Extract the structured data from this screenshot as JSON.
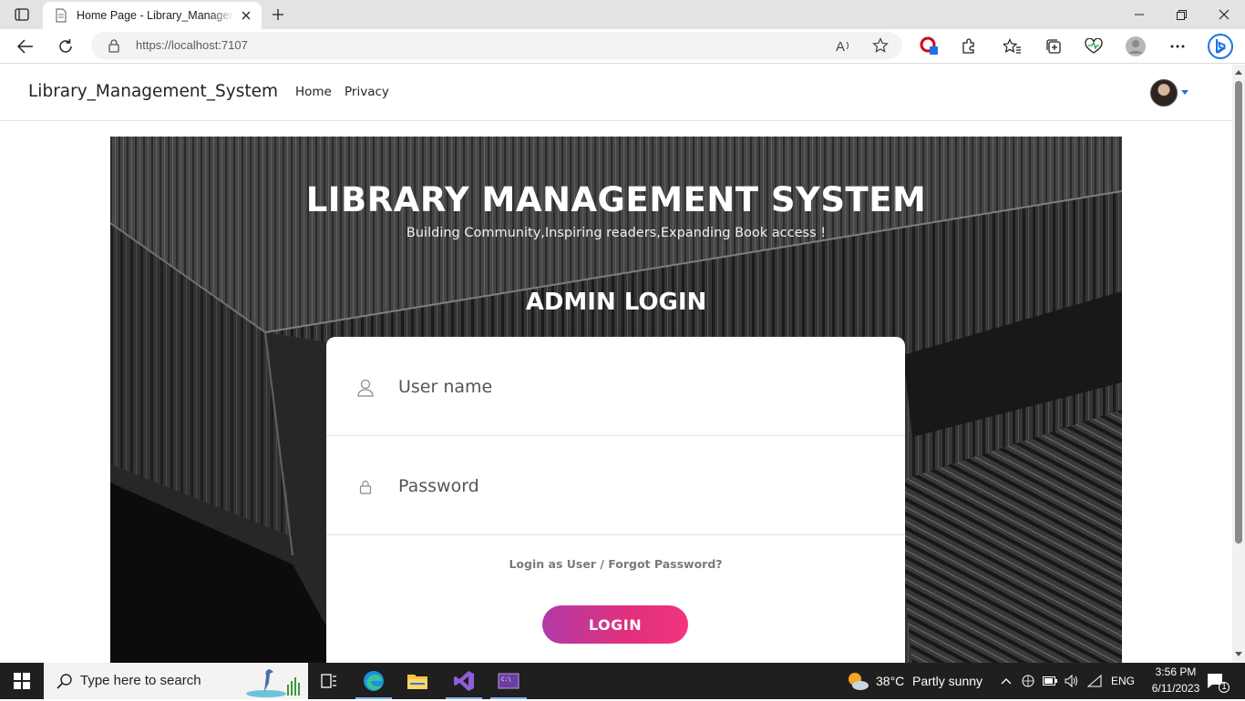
{
  "browser": {
    "tab_title": "Home Page - Library_Management_System",
    "url": "https://localhost:7107",
    "icons": [
      "tab-actions-icon",
      "page-favicon-icon",
      "close-tab-icon",
      "new-tab-icon",
      "minimize-icon",
      "restore-icon",
      "close-window-icon",
      "back-icon",
      "refresh-icon",
      "lock-icon",
      "read-aloud-icon",
      "favorite-star-icon",
      "extension-red-icon",
      "extensions-icon",
      "favorites-icon",
      "collections-icon",
      "performance-icon",
      "profile-icon",
      "more-icon",
      "bing-icon"
    ]
  },
  "navbar": {
    "brand": "Library_Management_System",
    "links": [
      "Home",
      "Privacy"
    ]
  },
  "hero": {
    "title": "LIBRARY MANAGEMENT SYSTEM",
    "subtitle": "Building Community,Inspiring readers,Expanding Book access !",
    "login_heading": "ADMIN LOGIN"
  },
  "form": {
    "username_placeholder": "User name",
    "password_placeholder": "Password",
    "forgot_link": "Login as User / Forgot Password?",
    "login_button": "LOGIN"
  },
  "taskbar": {
    "search_placeholder": "Type here to search",
    "weather_temp": "38°C",
    "weather_text": "Partly sunny",
    "language": "ENG",
    "time": "3:56 PM",
    "date": "6/11/2023",
    "notification_count": "1"
  },
  "colors": {
    "login_gradient_start": "#b13aa6",
    "login_gradient_end": "#f2357f",
    "taskbar": "#1f1f1f"
  }
}
